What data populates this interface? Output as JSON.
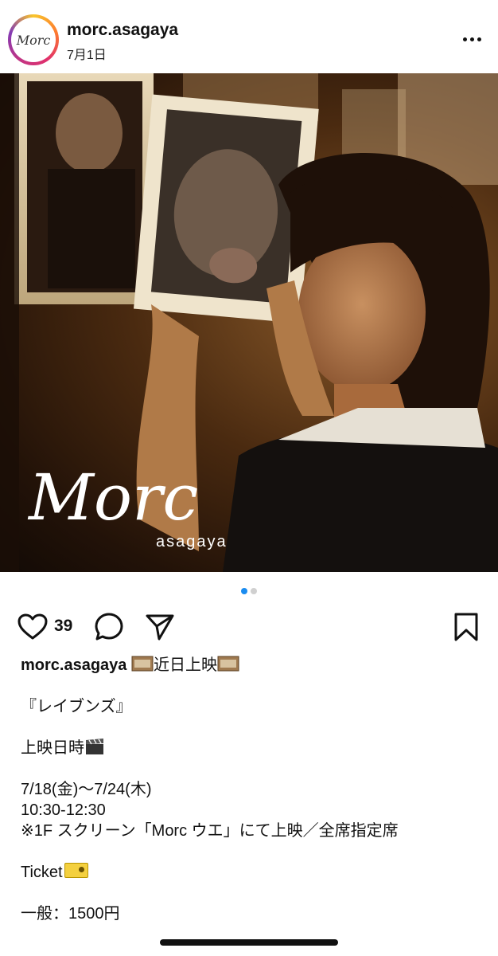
{
  "post": {
    "username": "morc.asagaya",
    "date": "7月1日",
    "avatar_text": "Morc"
  },
  "photo": {
    "logo_text": "Morc",
    "logo_subtext": "asagaya"
  },
  "carousel": {
    "total": 2,
    "active": 1
  },
  "actions": {
    "like_count": "39",
    "icons": [
      "heart-icon",
      "comment-icon",
      "share-icon",
      "bookmark-icon"
    ]
  },
  "caption": {
    "username": "morc.asagaya",
    "headline": "近日上映",
    "title": "『レイブンズ』",
    "schedule_label": "上映日時",
    "dates": "7/18(金)～7/24(木)",
    "time": "10:30-12:30",
    "note": "※1F スクリーン「Morc ウエ」にて上映／全席指定席",
    "ticket_label": "Ticket",
    "price": "一般：1500円"
  },
  "colors": {
    "active_dot": "#1a8cf0",
    "text": "#111111"
  }
}
